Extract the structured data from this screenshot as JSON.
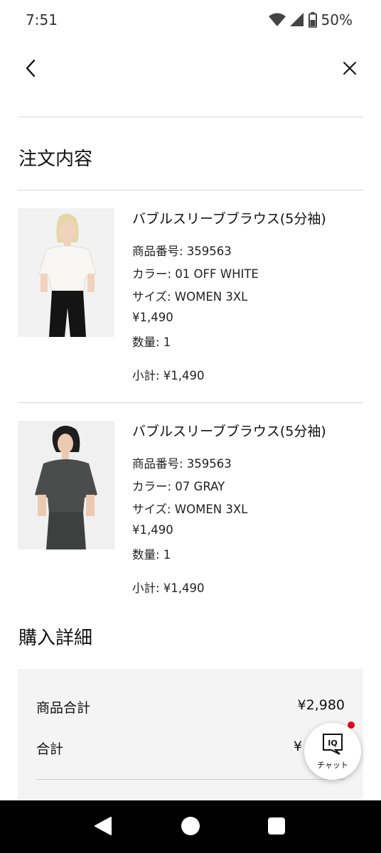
{
  "status": {
    "time": "7:51",
    "battery": "50%"
  },
  "order": {
    "title": "注文内容",
    "items": [
      {
        "name": "バブルスリーブブラウス(5分袖)",
        "product_no": "商品番号: 359563",
        "color": "カラー: 01 OFF WHITE",
        "size": "サイズ: WOMEN 3XL",
        "price": "¥1,490",
        "qty": "数量: 1",
        "subtotal": "小計: ¥1,490",
        "shirt_color": "#f3f2ee"
      },
      {
        "name": "バブルスリーブブラウス(5分袖)",
        "product_no": "商品番号: 359563",
        "color": "カラー: 07 GRAY",
        "size": "サイズ: WOMEN 3XL",
        "price": "¥1,490",
        "qty": "数量: 1",
        "subtotal": "小計: ¥1,490",
        "shirt_color": "#4b4d4c"
      }
    ]
  },
  "purchase": {
    "title": "購入詳細",
    "items_total_label": "商品合計",
    "items_total_value": "¥2,980",
    "total_label": "合計",
    "total_value": "¥"
  },
  "chat": {
    "label": "チャット",
    "icon_text": "IQ"
  },
  "colors": {
    "accent": "#e60012",
    "summary_bg": "#f4f4f4",
    "divider": "#d8d8d8"
  }
}
